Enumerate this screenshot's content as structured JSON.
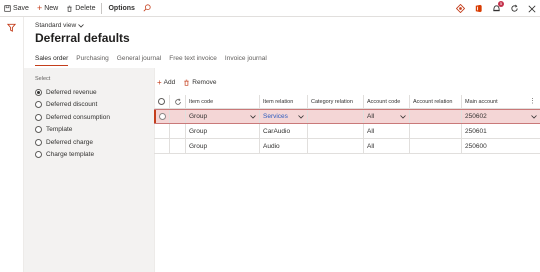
{
  "toolbar": {
    "save_label": "Save",
    "new_label": "New",
    "delete_label": "Delete",
    "options_label": "Options",
    "notification_count": "5"
  },
  "header": {
    "view_name": "Standard view",
    "title": "Deferral defaults"
  },
  "tabs": [
    {
      "label": "Sales order",
      "active": true
    },
    {
      "label": "Purchasing",
      "active": false
    },
    {
      "label": "General journal",
      "active": false
    },
    {
      "label": "Free text invoice",
      "active": false
    },
    {
      "label": "Invoice journal",
      "active": false
    }
  ],
  "select_panel": {
    "label": "Select",
    "options": [
      {
        "label": "Deferred revenue",
        "checked": true
      },
      {
        "label": "Deferred discount",
        "checked": false
      },
      {
        "label": "Deferred consumption",
        "checked": false
      },
      {
        "label": "Template",
        "checked": false
      },
      {
        "label": "Deferred charge",
        "checked": false
      },
      {
        "label": "Charge template",
        "checked": false
      }
    ]
  },
  "grid": {
    "add_label": "Add",
    "remove_label": "Remove",
    "columns": [
      "Item code",
      "Item relation",
      "Category relation",
      "Account code",
      "Account relation",
      "Main account"
    ],
    "rows": [
      {
        "item_code": "Group",
        "item_relation": "Services",
        "category_relation": "",
        "account_code": "All",
        "account_relation": "",
        "main_account": "250602",
        "selected": true
      },
      {
        "item_code": "Group",
        "item_relation": "CarAudio",
        "category_relation": "",
        "account_code": "All",
        "account_relation": "",
        "main_account": "250601",
        "selected": false
      },
      {
        "item_code": "Group",
        "item_relation": "Audio",
        "category_relation": "",
        "account_code": "All",
        "account_relation": "",
        "main_account": "250600",
        "selected": false
      }
    ]
  },
  "colors": {
    "accent": "#c43e1c",
    "selected_row": "#f4d6d6",
    "link": "#2b5bbf"
  }
}
